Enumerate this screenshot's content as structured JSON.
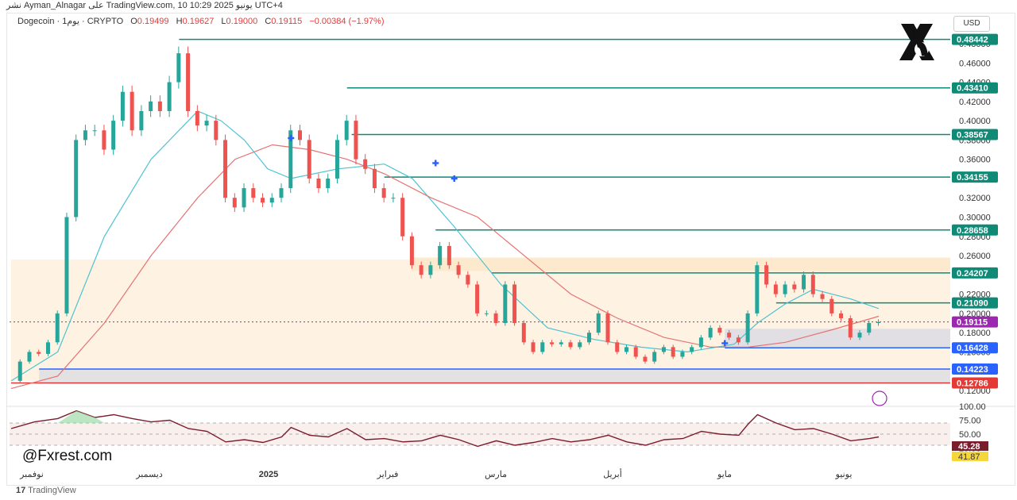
{
  "header": {
    "publisher_line": "نشر Ayman_Alnagar على TradingView.com, 10 يونيو 2025 10:29 UTC+4"
  },
  "legend": {
    "symbol": "Dogecoin · 1يوم · CRYPTO",
    "open_label": "O",
    "open_value": "0.19499",
    "high_label": "H",
    "high_value": "0.19627",
    "low_label": "L",
    "low_value": "0.19000",
    "close_label": "C",
    "close_value": "0.19115",
    "change": "−0.00384 (−1.97%)"
  },
  "currency": "USD",
  "watermark": "@Fxrest.com",
  "footer_logo": "TradingView",
  "colors": {
    "up": "#26a69a",
    "down": "#ef5350",
    "teal_level": "#0f8a77",
    "blue_level": "#2962ff",
    "red_level": "#e53935",
    "zone_fill": "#fde9cc",
    "ma_fast": "#4dc3d0",
    "ma_slow": "#e57373",
    "rsi": "#7b1c2c"
  },
  "chart_data": {
    "type": "candlestick",
    "title": "",
    "xlabel": "",
    "ylabel": "",
    "ylim": [
      0.11,
      0.5
    ],
    "y_ticks": [
      "0.48000",
      "0.46000",
      "0.44000",
      "0.42000",
      "0.40000",
      "0.38000",
      "0.36000",
      "0.34000",
      "0.32000",
      "0.30000",
      "0.28000",
      "0.26000",
      "0.24000",
      "0.22000",
      "0.20000",
      "0.18000",
      "0.16000",
      "0.14000",
      "0.12000"
    ],
    "x_labels": [
      "نوفمبر",
      "ديسمبر",
      "2025",
      "فبراير",
      "مارس",
      "أبريل",
      "مايو",
      "يونيو"
    ],
    "price_series": [
      {
        "x": 0,
        "y": 0.13
      },
      {
        "x": 2,
        "y": 0.15
      },
      {
        "x": 4,
        "y": 0.16
      },
      {
        "x": 6,
        "y": 0.158
      },
      {
        "x": 8,
        "y": 0.17
      },
      {
        "x": 10,
        "y": 0.2
      },
      {
        "x": 12,
        "y": 0.3
      },
      {
        "x": 14,
        "y": 0.38
      },
      {
        "x": 16,
        "y": 0.39
      },
      {
        "x": 18,
        "y": 0.39
      },
      {
        "x": 20,
        "y": 0.37
      },
      {
        "x": 22,
        "y": 0.4
      },
      {
        "x": 24,
        "y": 0.43
      },
      {
        "x": 26,
        "y": 0.39
      },
      {
        "x": 28,
        "y": 0.41
      },
      {
        "x": 30,
        "y": 0.42
      },
      {
        "x": 32,
        "y": 0.41
      },
      {
        "x": 34,
        "y": 0.44
      },
      {
        "x": 36,
        "y": 0.47
      },
      {
        "x": 38,
        "y": 0.41
      },
      {
        "x": 40,
        "y": 0.395
      },
      {
        "x": 42,
        "y": 0.4
      },
      {
        "x": 44,
        "y": 0.38
      },
      {
        "x": 46,
        "y": 0.32
      },
      {
        "x": 48,
        "y": 0.31
      },
      {
        "x": 50,
        "y": 0.33
      },
      {
        "x": 52,
        "y": 0.32
      },
      {
        "x": 54,
        "y": 0.315
      },
      {
        "x": 56,
        "y": 0.32
      },
      {
        "x": 58,
        "y": 0.33
      },
      {
        "x": 60,
        "y": 0.39
      },
      {
        "x": 62,
        "y": 0.38
      },
      {
        "x": 64,
        "y": 0.34
      },
      {
        "x": 66,
        "y": 0.33
      },
      {
        "x": 68,
        "y": 0.34
      },
      {
        "x": 70,
        "y": 0.38
      },
      {
        "x": 72,
        "y": 0.4
      },
      {
        "x": 74,
        "y": 0.36
      },
      {
        "x": 76,
        "y": 0.35
      },
      {
        "x": 78,
        "y": 0.33
      },
      {
        "x": 80,
        "y": 0.32
      },
      {
        "x": 82,
        "y": 0.32
      },
      {
        "x": 84,
        "y": 0.28
      },
      {
        "x": 86,
        "y": 0.25
      },
      {
        "x": 88,
        "y": 0.24
      },
      {
        "x": 90,
        "y": 0.25
      },
      {
        "x": 92,
        "y": 0.27
      },
      {
        "x": 94,
        "y": 0.25
      },
      {
        "x": 96,
        "y": 0.24
      },
      {
        "x": 98,
        "y": 0.23
      },
      {
        "x": 100,
        "y": 0.2
      },
      {
        "x": 102,
        "y": 0.2
      },
      {
        "x": 104,
        "y": 0.19
      },
      {
        "x": 106,
        "y": 0.23
      },
      {
        "x": 108,
        "y": 0.19
      },
      {
        "x": 110,
        "y": 0.17
      },
      {
        "x": 112,
        "y": 0.16
      },
      {
        "x": 114,
        "y": 0.17
      },
      {
        "x": 116,
        "y": 0.168
      },
      {
        "x": 118,
        "y": 0.17
      },
      {
        "x": 120,
        "y": 0.165
      },
      {
        "x": 122,
        "y": 0.17
      },
      {
        "x": 124,
        "y": 0.18
      },
      {
        "x": 126,
        "y": 0.2
      },
      {
        "x": 128,
        "y": 0.17
      },
      {
        "x": 130,
        "y": 0.16
      },
      {
        "x": 132,
        "y": 0.165
      },
      {
        "x": 134,
        "y": 0.155
      },
      {
        "x": 136,
        "y": 0.15
      },
      {
        "x": 138,
        "y": 0.16
      },
      {
        "x": 140,
        "y": 0.165
      },
      {
        "x": 142,
        "y": 0.155
      },
      {
        "x": 144,
        "y": 0.16
      },
      {
        "x": 146,
        "y": 0.165
      },
      {
        "x": 148,
        "y": 0.175
      },
      {
        "x": 150,
        "y": 0.185
      },
      {
        "x": 152,
        "y": 0.18
      },
      {
        "x": 154,
        "y": 0.175
      },
      {
        "x": 156,
        "y": 0.17
      },
      {
        "x": 158,
        "y": 0.2
      },
      {
        "x": 160,
        "y": 0.25
      },
      {
        "x": 162,
        "y": 0.23
      },
      {
        "x": 164,
        "y": 0.22
      },
      {
        "x": 166,
        "y": 0.23
      },
      {
        "x": 168,
        "y": 0.225
      },
      {
        "x": 170,
        "y": 0.24
      },
      {
        "x": 172,
        "y": 0.22
      },
      {
        "x": 174,
        "y": 0.215
      },
      {
        "x": 176,
        "y": 0.2
      },
      {
        "x": 178,
        "y": 0.195
      },
      {
        "x": 180,
        "y": 0.175
      },
      {
        "x": 182,
        "y": 0.18
      },
      {
        "x": 184,
        "y": 0.19
      },
      {
        "x": 186,
        "y": 0.191
      }
    ],
    "moving_averages": [
      {
        "name": "",
        "values": [
          {
            "x": 0,
            "y": 0.13
          },
          {
            "x": 10,
            "y": 0.16
          },
          {
            "x": 20,
            "y": 0.28
          },
          {
            "x": 30,
            "y": 0.36
          },
          {
            "x": 40,
            "y": 0.41
          },
          {
            "x": 45,
            "y": 0.4
          },
          {
            "x": 50,
            "y": 0.38
          },
          {
            "x": 55,
            "y": 0.35
          },
          {
            "x": 60,
            "y": 0.34
          },
          {
            "x": 70,
            "y": 0.35
          },
          {
            "x": 80,
            "y": 0.355
          },
          {
            "x": 86,
            "y": 0.34
          },
          {
            "x": 95,
            "y": 0.29
          },
          {
            "x": 105,
            "y": 0.23
          },
          {
            "x": 115,
            "y": 0.185
          },
          {
            "x": 125,
            "y": 0.173
          },
          {
            "x": 135,
            "y": 0.165
          },
          {
            "x": 145,
            "y": 0.16
          },
          {
            "x": 155,
            "y": 0.168
          },
          {
            "x": 160,
            "y": 0.19
          },
          {
            "x": 166,
            "y": 0.21
          },
          {
            "x": 172,
            "y": 0.225
          },
          {
            "x": 180,
            "y": 0.215
          },
          {
            "x": 186,
            "y": 0.205
          }
        ]
      },
      {
        "name": "",
        "values": [
          {
            "x": 0,
            "y": 0.122
          },
          {
            "x": 10,
            "y": 0.135
          },
          {
            "x": 20,
            "y": 0.19
          },
          {
            "x": 30,
            "y": 0.26
          },
          {
            "x": 40,
            "y": 0.32
          },
          {
            "x": 48,
            "y": 0.36
          },
          {
            "x": 56,
            "y": 0.375
          },
          {
            "x": 64,
            "y": 0.37
          },
          {
            "x": 72,
            "y": 0.36
          },
          {
            "x": 80,
            "y": 0.345
          },
          {
            "x": 90,
            "y": 0.32
          },
          {
            "x": 100,
            "y": 0.3
          },
          {
            "x": 110,
            "y": 0.26
          },
          {
            "x": 120,
            "y": 0.22
          },
          {
            "x": 130,
            "y": 0.195
          },
          {
            "x": 140,
            "y": 0.175
          },
          {
            "x": 150,
            "y": 0.165
          },
          {
            "x": 158,
            "y": 0.165
          },
          {
            "x": 166,
            "y": 0.17
          },
          {
            "x": 176,
            "y": 0.183
          },
          {
            "x": 186,
            "y": 0.197
          }
        ]
      }
    ],
    "levels": [
      {
        "value": 0.48442,
        "label": "0.48442",
        "color": "teal",
        "x_start": 36
      },
      {
        "value": 0.4341,
        "label": "0.43410",
        "color": "teal",
        "x_start": 72
      },
      {
        "value": 0.38567,
        "label": "0.38567",
        "color": "teal",
        "x_start": 73
      },
      {
        "value": 0.34155,
        "label": "0.34155",
        "color": "teal",
        "x_start": 80
      },
      {
        "value": 0.28658,
        "label": "0.28658",
        "color": "teal",
        "x_start": 91
      },
      {
        "value": 0.24207,
        "label": "0.24207",
        "color": "teal",
        "x_start": 103
      },
      {
        "value": 0.2109,
        "label": "0.21090",
        "color": "teal",
        "x_start": 164
      },
      {
        "value": 0.16428,
        "label": "0.16428",
        "color": "blue",
        "x_start": 153
      },
      {
        "value": 0.14223,
        "label": "0.14223",
        "color": "blue",
        "x_start": 6
      },
      {
        "value": 0.12786,
        "label": "0.12786",
        "color": "red",
        "x_start": 0
      }
    ],
    "current_price": {
      "value": 0.19115,
      "label": "0.19115"
    },
    "zones": [
      {
        "from": 0.244,
        "to": 0.258,
        "x_start": 86
      },
      {
        "from": 0.13,
        "to": 0.256,
        "x_start": 0
      }
    ],
    "rsi": {
      "ylim": [
        0,
        100
      ],
      "y_ticks": [
        "100.00",
        "75.00",
        "50.00",
        "25.00"
      ],
      "value_label": "45.28",
      "ma_label": "41.87",
      "values": [
        {
          "x": 0,
          "y": 60
        },
        {
          "x": 5,
          "y": 72
        },
        {
          "x": 10,
          "y": 78
        },
        {
          "x": 14,
          "y": 92
        },
        {
          "x": 18,
          "y": 80
        },
        {
          "x": 22,
          "y": 85
        },
        {
          "x": 26,
          "y": 78
        },
        {
          "x": 30,
          "y": 72
        },
        {
          "x": 34,
          "y": 75
        },
        {
          "x": 38,
          "y": 60
        },
        {
          "x": 42,
          "y": 55
        },
        {
          "x": 46,
          "y": 36
        },
        {
          "x": 50,
          "y": 40
        },
        {
          "x": 54,
          "y": 35
        },
        {
          "x": 58,
          "y": 45
        },
        {
          "x": 60,
          "y": 62
        },
        {
          "x": 64,
          "y": 48
        },
        {
          "x": 68,
          "y": 45
        },
        {
          "x": 72,
          "y": 60
        },
        {
          "x": 76,
          "y": 40
        },
        {
          "x": 80,
          "y": 42
        },
        {
          "x": 84,
          "y": 36
        },
        {
          "x": 88,
          "y": 38
        },
        {
          "x": 92,
          "y": 48
        },
        {
          "x": 96,
          "y": 40
        },
        {
          "x": 100,
          "y": 28
        },
        {
          "x": 104,
          "y": 38
        },
        {
          "x": 108,
          "y": 30
        },
        {
          "x": 112,
          "y": 35
        },
        {
          "x": 116,
          "y": 42
        },
        {
          "x": 120,
          "y": 36
        },
        {
          "x": 124,
          "y": 40
        },
        {
          "x": 128,
          "y": 48
        },
        {
          "x": 132,
          "y": 36
        },
        {
          "x": 136,
          "y": 30
        },
        {
          "x": 140,
          "y": 40
        },
        {
          "x": 144,
          "y": 42
        },
        {
          "x": 148,
          "y": 55
        },
        {
          "x": 152,
          "y": 50
        },
        {
          "x": 156,
          "y": 48
        },
        {
          "x": 158,
          "y": 68
        },
        {
          "x": 160,
          "y": 85
        },
        {
          "x": 164,
          "y": 70
        },
        {
          "x": 168,
          "y": 58
        },
        {
          "x": 172,
          "y": 60
        },
        {
          "x": 176,
          "y": 50
        },
        {
          "x": 180,
          "y": 38
        },
        {
          "x": 184,
          "y": 42
        },
        {
          "x": 186,
          "y": 45
        }
      ]
    }
  }
}
